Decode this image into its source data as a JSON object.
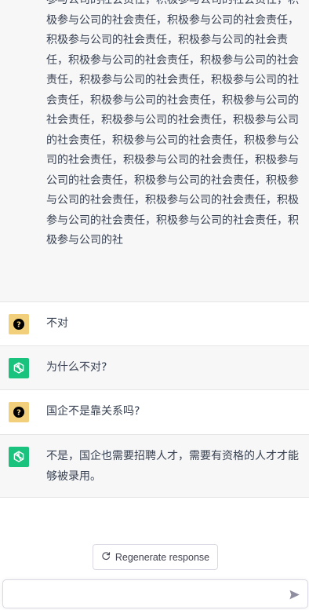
{
  "conversation": {
    "messages": [
      {
        "role": "assistant",
        "text": "参与公司的社会责任，积极参与公司的社会责任，积极参与公司的社会责任，积极参与公司的社会责任，积极参与公司的社会责任，积极参与公司的社会责任，积极参与公司的社会责任，积极参与公司的社会责任，积极参与公司的社会责任，积极参与公司的社会责任，积极参与公司的社会责任，积极参与公司的社会责任，积极参与公司的社会责任，积极参与公司的社会责任，积极参与公司的社会责任，积极参与公司的社会责任，积极参与公司的社会责任，积极参与公司的社会责任，积极参与公司的社会责任，积极参与公司的社会责任，积极参与公司的社会责任，积极参与公司的社会责任，积极参与公司的社会责任，积极参与公司的社"
      },
      {
        "role": "user",
        "text": "不对"
      },
      {
        "role": "assistant",
        "text": "为什么不对?"
      },
      {
        "role": "user",
        "text": "国企不是靠关系吗?"
      },
      {
        "role": "assistant",
        "text": "不是，国企也需要招聘人才，需要有资格的人才才能够被录用。"
      }
    ]
  },
  "controls": {
    "regenerate_label": "Regenerate response",
    "input_value": "",
    "input_placeholder": ""
  },
  "icons": {
    "user_avatar": "question-mark-icon",
    "assistant_avatar": "openai-logo-icon",
    "regenerate": "refresh-icon",
    "send": "send-icon"
  },
  "colors": {
    "assistant_bg": "#f7f7f8",
    "user_avatar_bg": "#f2cf7a",
    "assistant_avatar_bg": "#19c37d"
  }
}
